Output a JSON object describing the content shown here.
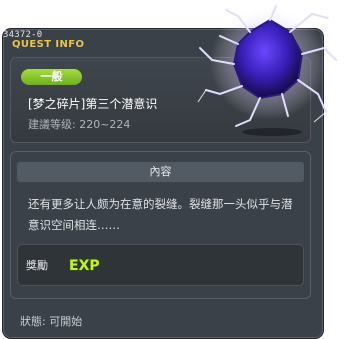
{
  "window": {
    "quest_id": "34372-0",
    "header_title": "QUEST INFO"
  },
  "quest": {
    "category_badge": "一般",
    "title": "[梦之碎片]第三个潜意识",
    "level_requirement": "建議等级: 220~224"
  },
  "content": {
    "section_title": "內容",
    "description": "还有更多让人颇为在意的裂缝。裂缝那一头似乎与潜意识空间相连……"
  },
  "reward": {
    "label": "獎勵",
    "exp_text": "EXP"
  },
  "status": {
    "text": "狀態: 可開始"
  },
  "colors": {
    "badge_green": "#8ccf2e",
    "exp_yellow_green": "#c6f02a",
    "title_gold": "#e8c44a",
    "crystal_purple": "#4a2fd0"
  },
  "icons": [
    "dream-crystal-icon",
    "exp-icon"
  ]
}
